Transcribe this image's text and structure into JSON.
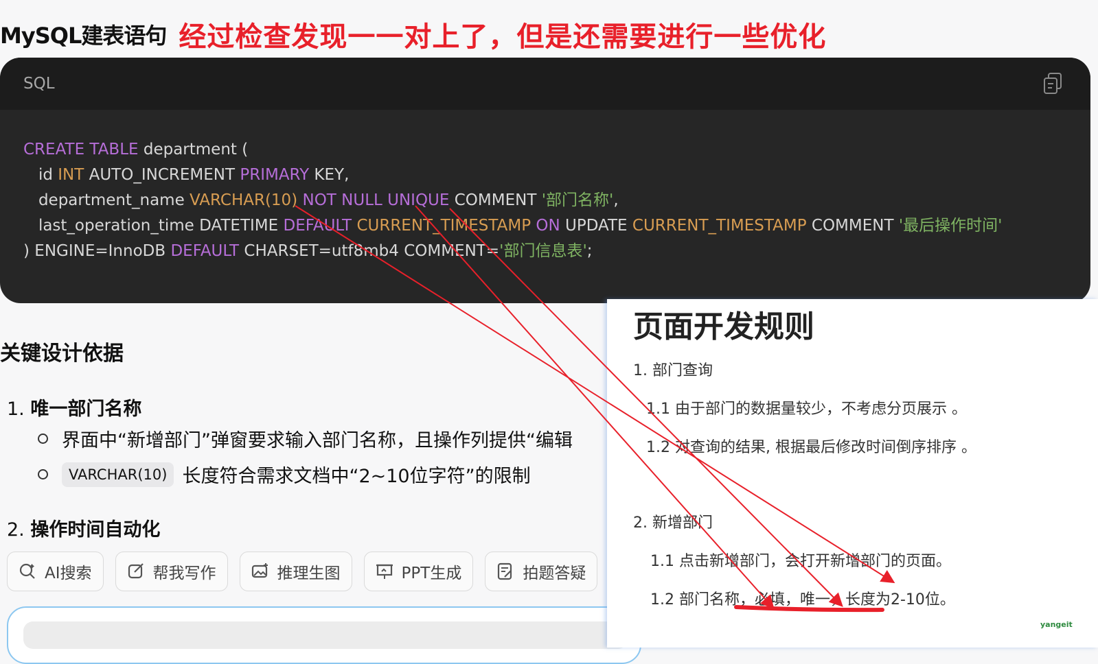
{
  "header": {
    "title": "MySQL建表语句",
    "annotation": "经过检查发现一一对上了，但是还需要进行一些优化"
  },
  "code_block": {
    "language": "SQL",
    "copy_icon": "copy-icon",
    "lines": [
      "CREATE TABLE department (",
      "id INT AUTO_INCREMENT PRIMARY KEY,",
      "department_name VARCHAR(10) NOT NULL UNIQUE COMMENT '部门名称',",
      "last_operation_time DATETIME DEFAULT CURRENT_TIMESTAMP ON UPDATE CURRENT_TIMESTAMP COMMENT '最后操作时间'",
      ") ENGINE=InnoDB DEFAULT CHARSET=utf8mb4 COMMENT='部门信息表';"
    ],
    "tokens": {
      "l1_kw": "CREATE TABLE",
      "l1_rest": " department (",
      "l2_id": "id ",
      "l2_int": "INT",
      "l2_ai": " AUTO_INCREMENT ",
      "l2_pk": "PRIMARY",
      "l2_key": " KEY,",
      "l3_name": "department_name ",
      "l3_varchar": "VARCHAR(10)",
      "l3_sp": " ",
      "l3_nn": "NOT NULL UNIQUE",
      "l3_comment": " COMMENT ",
      "l3_str": "'部门名称'",
      "l3_end": ",",
      "l4_name": "last_operation_time DATETIME ",
      "l4_default": "DEFAULT",
      "l4_sp": " ",
      "l4_ct1": "CURRENT_TIMESTAMP",
      "l4_sp2": " ",
      "l4_on": "ON",
      "l4_update": " UPDATE ",
      "l4_ct2": "CURRENT_TIMESTAMP",
      "l4_comment": " COMMENT ",
      "l4_str": "'最后操作时间'",
      "l5_a": ") ENGINE=InnoDB ",
      "l5_default": "DEFAULT",
      "l5_b": " CHARSET=utf8mb4 COMMENT=",
      "l5_str": "'部门信息表'",
      "l5_end": ";"
    }
  },
  "section": {
    "heading": "关键设计依据",
    "items": [
      {
        "num": "1.",
        "title": "唯一部门名称",
        "bullets": [
          "界面中“新增部门”弹窗要求输入部门名称，且操作列提供“编辑",
          "长度符合需求文档中“2~10位字符”的限制"
        ],
        "inline_code": "VARCHAR(10)"
      },
      {
        "num": "2.",
        "title": "操作时间自动化"
      }
    ]
  },
  "toolbar": {
    "buttons": [
      {
        "label": "AI搜索",
        "icon": "ai-search-icon"
      },
      {
        "label": "帮我写作",
        "icon": "edit-icon"
      },
      {
        "label": "推理生图",
        "icon": "image-gen-icon"
      },
      {
        "label": "PPT生成",
        "icon": "ppt-icon"
      },
      {
        "label": "拍题答疑",
        "icon": "photo-question-icon"
      }
    ]
  },
  "doc": {
    "title": "页面开发规则",
    "lines": [
      "1. 部门查询",
      "1.1  由于部门的数据量较少，不考虑分页展示 。",
      "1.2  对查询的结果, 根据最后修改时间倒序排序 。",
      "2. 新增部门",
      "1.1 点击新增部门，会打开新增部门的页面。",
      "1.2 部门名称，必填，唯一，长度为2-10位。"
    ]
  },
  "watermark": "yangeit",
  "colors": {
    "annotation_red": "#e8202a",
    "code_bg": "#262626",
    "keyword": "#b66ed8",
    "type": "#d89d52",
    "string": "#7fb362"
  }
}
